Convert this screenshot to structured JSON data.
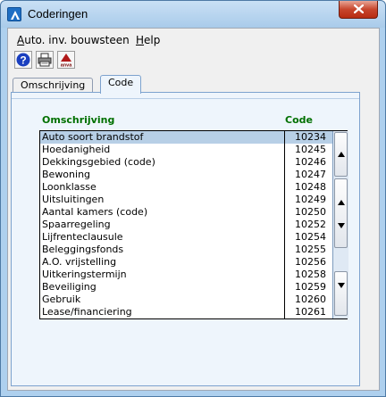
{
  "window": {
    "title": "Coderingen"
  },
  "menu": {
    "item1": "Auto. inv. bouwsteen",
    "item1_mnemonic": "A",
    "item1_rest": "uto. inv. bouwsteen",
    "item2": "Help",
    "item2_mnemonic": "H",
    "item2_rest": "elp"
  },
  "toolbar": {
    "buttons": [
      "help-icon",
      "printer-icon",
      "anva-logo-icon"
    ],
    "logo_text": "anva"
  },
  "tabs": [
    {
      "label": "Omschrijving",
      "active": false
    },
    {
      "label": "Code",
      "active": true
    }
  ],
  "list": {
    "columns": {
      "name": "Omschrijving",
      "code": "Code"
    },
    "rows": [
      {
        "name": "Auto soort brandstof",
        "code": "10234",
        "selected": true
      },
      {
        "name": "Hoedanigheid",
        "code": "10245"
      },
      {
        "name": "Dekkingsgebied (code)",
        "code": "10246"
      },
      {
        "name": "Bewoning",
        "code": "10247"
      },
      {
        "name": "Loonklasse",
        "code": "10248"
      },
      {
        "name": "Uitsluitingen",
        "code": "10249"
      },
      {
        "name": "Aantal kamers (code)",
        "code": "10250"
      },
      {
        "name": "Spaarregeling",
        "code": "10252"
      },
      {
        "name": "Lijfrenteclausule",
        "code": "10254"
      },
      {
        "name": "Beleggingsfonds",
        "code": "10255"
      },
      {
        "name": "A.O. vrijstelling",
        "code": "10256"
      },
      {
        "name": "Uitkeringstermijn",
        "code": "10258"
      },
      {
        "name": "Beveiliging",
        "code": "10259"
      },
      {
        "name": "Gebruik",
        "code": "10260"
      },
      {
        "name": "Lease/financiering",
        "code": "10261"
      }
    ]
  },
  "colors": {
    "header_green": "#007000",
    "selection": "#b7cfe6",
    "title_bar": "#aed0ee",
    "close_red": "#c7462d"
  }
}
